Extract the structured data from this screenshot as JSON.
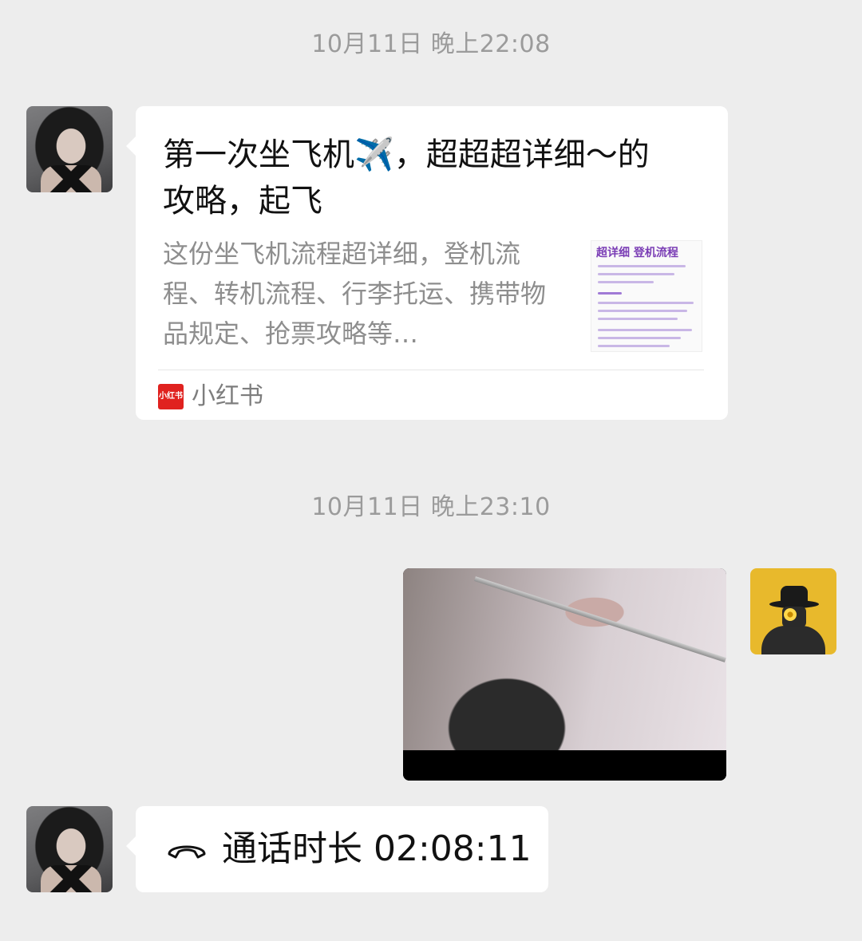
{
  "messages": {
    "timestamp_1": "10月11日 晚上22:08",
    "card": {
      "title": "第一次坐飞机✈️，超超超详细～的攻略，起飞",
      "description": "这份坐飞机流程超详细，登机流程、转机流程、行李托运、携带物品规定、抢票攻略等…",
      "thumbnail_header": "超详细 登机流程",
      "source_logo": "小红书",
      "source_name": "小红书"
    },
    "timestamp_2": "10月11日 晚上23:10",
    "call": {
      "label": "通话时长 02:08:11"
    }
  },
  "colors": {
    "background": "#ededed",
    "bubble": "#ffffff",
    "timestamp_text": "#9b9b9b",
    "xiaohongshu_red": "#e0221f"
  },
  "icons": {
    "call": "phone-hangup-icon"
  }
}
